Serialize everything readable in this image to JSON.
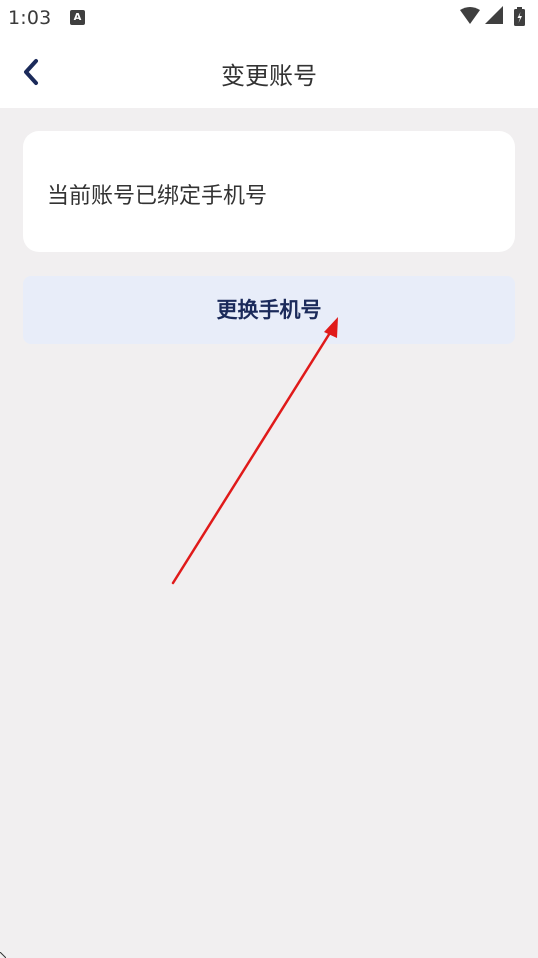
{
  "status_bar": {
    "time": "1:03",
    "notification_letter": "A",
    "icons": [
      "wifi-icon",
      "cellular-signal-icon",
      "battery-charging-icon"
    ]
  },
  "header": {
    "title": "变更账号",
    "back_icon": "chevron-left-icon"
  },
  "account_card": {
    "text": "当前账号已绑定手机号"
  },
  "change_button": {
    "label": "更换手机号"
  },
  "annotation": {
    "type": "red-arrow",
    "color": "#e01a1a"
  },
  "colors": {
    "page_background": "#f1eff0",
    "header_background": "#ffffff",
    "button_background": "#e8edf9",
    "button_text": "#1b2a5a",
    "back_icon": "#1b2a5a",
    "annotation_arrow": "#e01a1a"
  }
}
